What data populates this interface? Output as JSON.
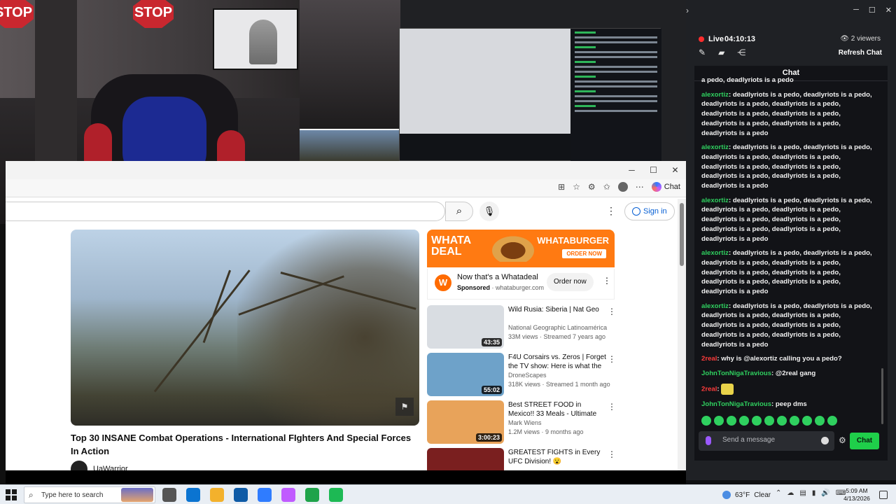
{
  "webcam": {
    "stop_sign": "STOP"
  },
  "browser": {
    "toolbar": {
      "copilot_label": "Chat"
    },
    "youtube": {
      "signin_label": "Sign in",
      "video_title": "Top 30 INSANE Combat Operations - International FIghters And Special Forces In Action",
      "channel_name": "UaWarrior",
      "ad": {
        "banner_left": "WHATA\nDEAL",
        "banner_brand": "WHATABURGER",
        "banner_cta": "ORDER NOW",
        "headline": "Now that's a Whatadeal",
        "sponsored": "Sponsored",
        "domain": "whataburger.com",
        "order_button": "Order now"
      },
      "recommendations": [
        {
          "title": "Wild Rusia: Siberia | Nat Geo",
          "channel": "National Geographic Latinoamérica",
          "meta": "33M views · Streamed 7 years ago",
          "duration": "43:35",
          "thumb_color": "#d9dde2"
        },
        {
          "title": "F4U Corsairs vs. Zeros | Forget the TV show: Here is what the ...",
          "channel": "DroneScapes",
          "meta": "318K views · Streamed 1 month ago",
          "duration": "55:02",
          "thumb_color": "#6ea2c9"
        },
        {
          "title": "Best STREET FOOD in Mexico!! 33 Meals - Ultimate Mexican ...",
          "channel": "Mark Wiens",
          "meta": "1.2M views · 9 months ago",
          "duration": "3:00:23",
          "thumb_color": "#e8a35a"
        },
        {
          "title": "GREATEST FIGHTS in Every UFC Division! 😮",
          "channel": "",
          "meta": "",
          "duration": "",
          "thumb_color": "#7a1f1f"
        }
      ]
    }
  },
  "chat": {
    "live_label": "Live",
    "live_time": "04:10:13",
    "viewers": "2 viewers",
    "refresh_label": "Refresh Chat",
    "panel_title": "Chat",
    "top_fragment": "a pedo, deadlyriots is a pedo",
    "messages": [
      {
        "user": "alexortiz",
        "text": "deadlyriots is a pedo, deadlyriots is a pedo, deadlyriots is a pedo, deadlyriots is a pedo, deadlyriots is a pedo, deadlyriots is a pedo, deadlyriots is a pedo, deadlyriots is a pedo, deadlyriots is a pedo",
        "color": "green"
      },
      {
        "user": "alexortiz",
        "text": "deadlyriots is a pedo, deadlyriots is a pedo, deadlyriots is a pedo, deadlyriots is a pedo, deadlyriots is a pedo, deadlyriots is a pedo, deadlyriots is a pedo, deadlyriots is a pedo, deadlyriots is a pedo",
        "color": "green"
      },
      {
        "user": "alexortiz",
        "text": "deadlyriots is a pedo, deadlyriots is a pedo, deadlyriots is a pedo, deadlyriots is a pedo, deadlyriots is a pedo, deadlyriots is a pedo, deadlyriots is a pedo, deadlyriots is a pedo, deadlyriots is a pedo",
        "color": "green"
      },
      {
        "user": "alexortiz",
        "text": "deadlyriots is a pedo, deadlyriots is a pedo, deadlyriots is a pedo, deadlyriots is a pedo, deadlyriots is a pedo, deadlyriots is a pedo, deadlyriots is a pedo, deadlyriots is a pedo, deadlyriots is a pedo",
        "color": "green"
      },
      {
        "user": "alexortiz",
        "text": "deadlyriots is a pedo, deadlyriots is a pedo, deadlyriots is a pedo, deadlyriots is a pedo, deadlyriots is a pedo, deadlyriots is a pedo, deadlyriots is a pedo, deadlyriots is a pedo, deadlyriots is a pedo",
        "color": "green"
      },
      {
        "user": "2real",
        "text": "why is @alexortiz calling you a pedo?",
        "color": "red"
      },
      {
        "user": "JohnTonNigaTravious",
        "text": "@2real gang",
        "color": "green"
      },
      {
        "user": "2real",
        "text": "",
        "color": "red",
        "emote": true
      },
      {
        "user": "JohnTonNigaTravious",
        "text": "peep dms",
        "color": "green"
      }
    ],
    "input_placeholder": "Send a message",
    "send_label": "Chat"
  },
  "taskbar": {
    "search_placeholder": "Type here to search",
    "weather_temp": "63°F",
    "weather_desc": "Clear",
    "time": "5:09 AM",
    "date": "4/13/2026",
    "app_colors": [
      "#555",
      "#0b74d1",
      "#f3b12c",
      "#0f5ba6",
      "#2f7cff",
      "#c05bff",
      "#1fa34a",
      "#1db954"
    ]
  }
}
